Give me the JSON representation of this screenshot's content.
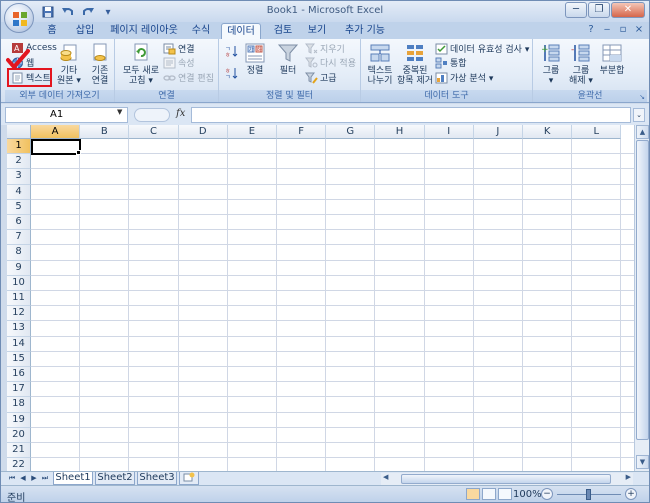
{
  "window": {
    "title": "Book1 - Microsoft Excel",
    "controls": {
      "minimize": "─",
      "restore": "❐",
      "close": "✕"
    }
  },
  "quick_access": {
    "save_icon": "save-icon",
    "undo_icon": "undo-icon",
    "redo_icon": "redo-icon",
    "customize_icon": "chevron-down-icon"
  },
  "ribbon_tabs": [
    "홈",
    "삽입",
    "페이지 레이아웃",
    "수식",
    "데이터",
    "검토",
    "보기",
    "추가 기능"
  ],
  "active_tab": "데이터",
  "ribbon": {
    "external_data": {
      "label": "외부 데이터 가져오기",
      "access": "Access",
      "web": "웹",
      "text": "텍스트",
      "other_sources_1": "기타",
      "other_sources_2": "원본 ▾",
      "existing_1": "기존",
      "existing_2": "연결"
    },
    "connections": {
      "label": "연결",
      "refresh_1": "모두 새로",
      "refresh_2": "고침 ▾",
      "connections": "연결",
      "properties": "속성",
      "edit_links": "연결 편집"
    },
    "sort_filter": {
      "label": "정렬 및 필터",
      "sort": "정렬",
      "filter": "필터",
      "clear": "지우기",
      "reapply": "다시 적용",
      "advanced": "고급",
      "sort_icon_text": "가 하"
    },
    "data_tools": {
      "label": "데이터 도구",
      "text_to_columns_1": "텍스트",
      "text_to_columns_2": "나누기",
      "remove_dup_1": "중복된",
      "remove_dup_2": "항목 제거",
      "validation": "데이터 유효성 검사 ▾",
      "consolidate": "통합",
      "what_if": "가상 분석 ▾"
    },
    "outline": {
      "label": "윤곽선",
      "group_1": "그룹",
      "group_2": "▾",
      "ungroup_1": "그룹",
      "ungroup_2": "해제 ▾",
      "subtotal": "부분합"
    }
  },
  "formula_bar": {
    "name_box": "A1",
    "fx": "fx",
    "value": ""
  },
  "columns": [
    "A",
    "B",
    "C",
    "D",
    "E",
    "F",
    "G",
    "H",
    "I",
    "J",
    "K",
    "L"
  ],
  "rows": [
    "1",
    "2",
    "3",
    "4",
    "5",
    "6",
    "7",
    "8",
    "9",
    "10",
    "11",
    "12",
    "13",
    "14",
    "15",
    "16",
    "17",
    "18",
    "19",
    "20",
    "21",
    "22"
  ],
  "selected_cell": "A1",
  "sheets": [
    "Sheet1",
    "Sheet2",
    "Sheet3"
  ],
  "active_sheet": "Sheet1",
  "status": {
    "ready": "준비",
    "zoom": "100%"
  },
  "colors": {
    "highlight": "#e3151f",
    "accent": "#15428b",
    "selection": "#f1c15f"
  }
}
